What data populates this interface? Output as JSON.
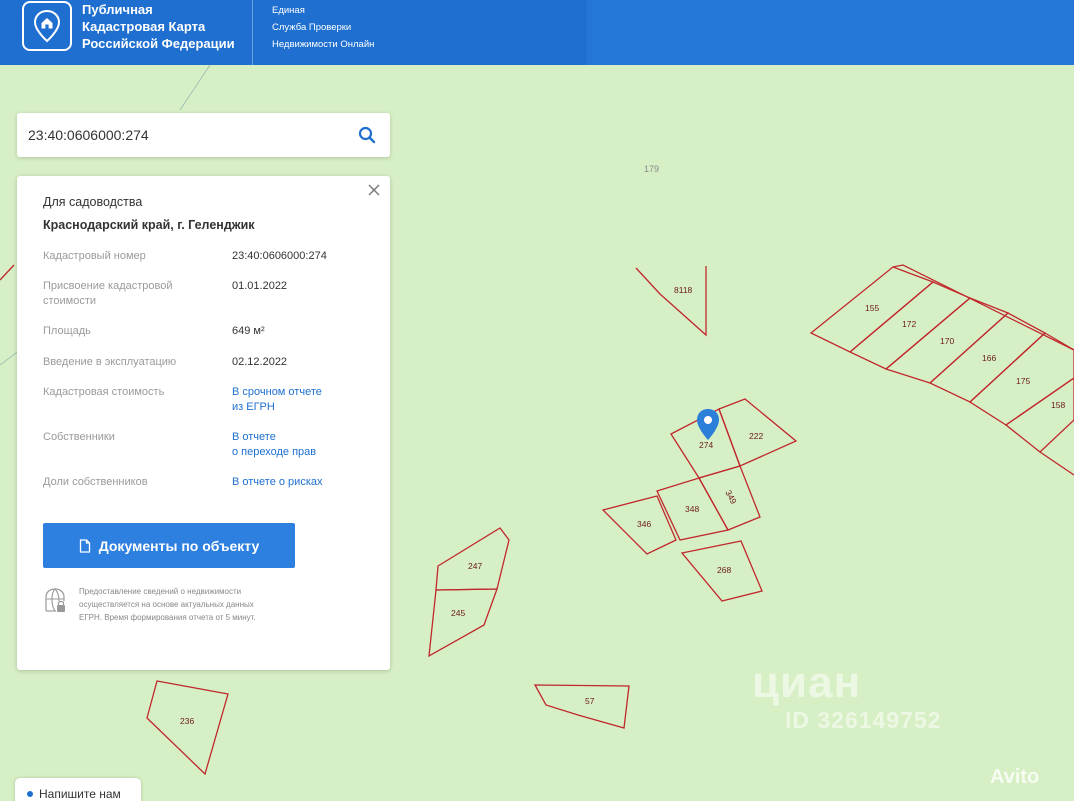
{
  "header": {
    "title_line1": "Публичная",
    "title_line2": "Кадастровая Карта",
    "title_line3": "Российской Федерации",
    "service_line1": "Единая",
    "service_line2": "Служба Проверки",
    "service_line3": "Недвижимости Онлайн"
  },
  "search": {
    "value": "23:40:0606000:274"
  },
  "card": {
    "type": "Для садоводства",
    "address": "Краснодарский край, г. Геленджик",
    "props": {
      "cadastral_number_label": "Кадастровый номер",
      "cadastral_number_value": "23:40:0606000:274",
      "valuation_date_label_1": "Присвоение кадастровой",
      "valuation_date_label_2": "стоимости",
      "valuation_date_value": "01.01.2022",
      "area_label": "Площадь",
      "area_value": "649 м²",
      "commissioning_label": "Введение в эксплуатацию",
      "commissioning_value": "02.12.2022",
      "cadastral_value_label": "Кадастровая стоимость",
      "cadastral_value_link_1": "В срочном отчете",
      "cadastral_value_link_2": "из ЕГРН",
      "owners_label": "Собственники",
      "owners_link_1": "В отчете",
      "owners_link_2": "о переходе прав",
      "shares_label": "Доли собственников",
      "shares_link": "В отчете о рисках"
    },
    "documents_button": "Документы по объекту",
    "note_1": "Предоставление сведений о недвижимости",
    "note_2": "осуществляется на основе актуальных данных",
    "note_3": "ЕГРН. Время формирования отчета от 5 минут."
  },
  "map": {
    "area_label": "179",
    "parcels": {
      "p8118": "8118",
      "p155": "155",
      "p172": "172",
      "p170": "170",
      "p166": "166",
      "p175": "175",
      "p158": "158",
      "p274": "274",
      "p222": "222",
      "p348": "348",
      "p349": "349",
      "p346": "346",
      "p268": "268",
      "p247": "247",
      "p245": "245",
      "p57": "57",
      "p236": "236"
    },
    "parcel_color": "#c0282d",
    "marker_color": "#2b7fd8"
  },
  "widgets": {
    "write_us": "Напишите нам"
  },
  "watermarks": {
    "cian": "циан",
    "cian_id": "ID 326149752",
    "avito": "Avito"
  },
  "colors": {
    "header_bg": "#1e6fd0",
    "map_bg": "#d7efc4",
    "button_bg": "#2d7fe0",
    "link": "#1e6fd0"
  }
}
